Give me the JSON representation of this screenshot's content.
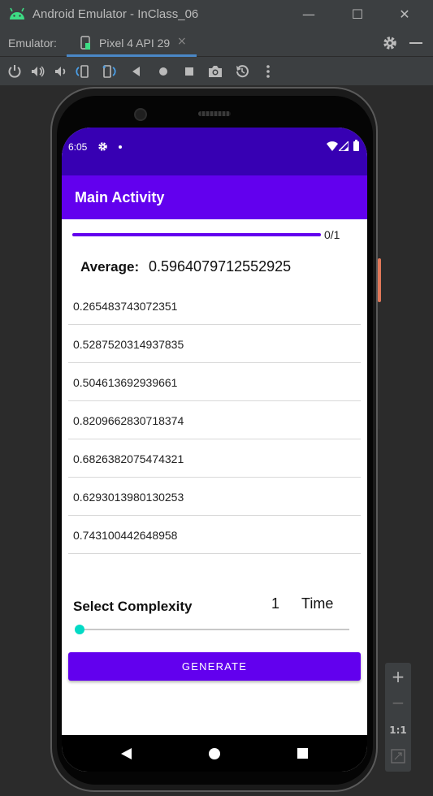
{
  "window": {
    "title": "Android Emulator - InClass_06",
    "minimize": "—",
    "maximize": "☐",
    "close": "✕"
  },
  "tabbar": {
    "emulator_label": "Emulator:",
    "device_tab": "Pixel 4 API 29",
    "tab_close": "×"
  },
  "status_bar": {
    "time": "6:05"
  },
  "app_bar": {
    "title": "Main Activity"
  },
  "progress": {
    "text": "0/1",
    "fraction": 1.0
  },
  "average": {
    "label": "Average:",
    "value": "0.5964079712552925"
  },
  "numbers": [
    "0.265483743072351",
    "0.5287520314937835",
    "0.504613692939661",
    "0.8209662830718374",
    "0.6826382075474321",
    "0.6293013980130253",
    "0.743100442648958"
  ],
  "complexity": {
    "label": "Select Complexity",
    "value": "1",
    "unit": "Time",
    "slider_fraction": 0.0
  },
  "generate_button": {
    "label": "GENERATE"
  },
  "side_controls": {
    "zoom_in": "+",
    "zoom_out": "−",
    "one_to_one": "1:1"
  },
  "colors": {
    "primary": "#6200ee",
    "primary_dark": "#3700b3",
    "accent": "#03dac5"
  }
}
